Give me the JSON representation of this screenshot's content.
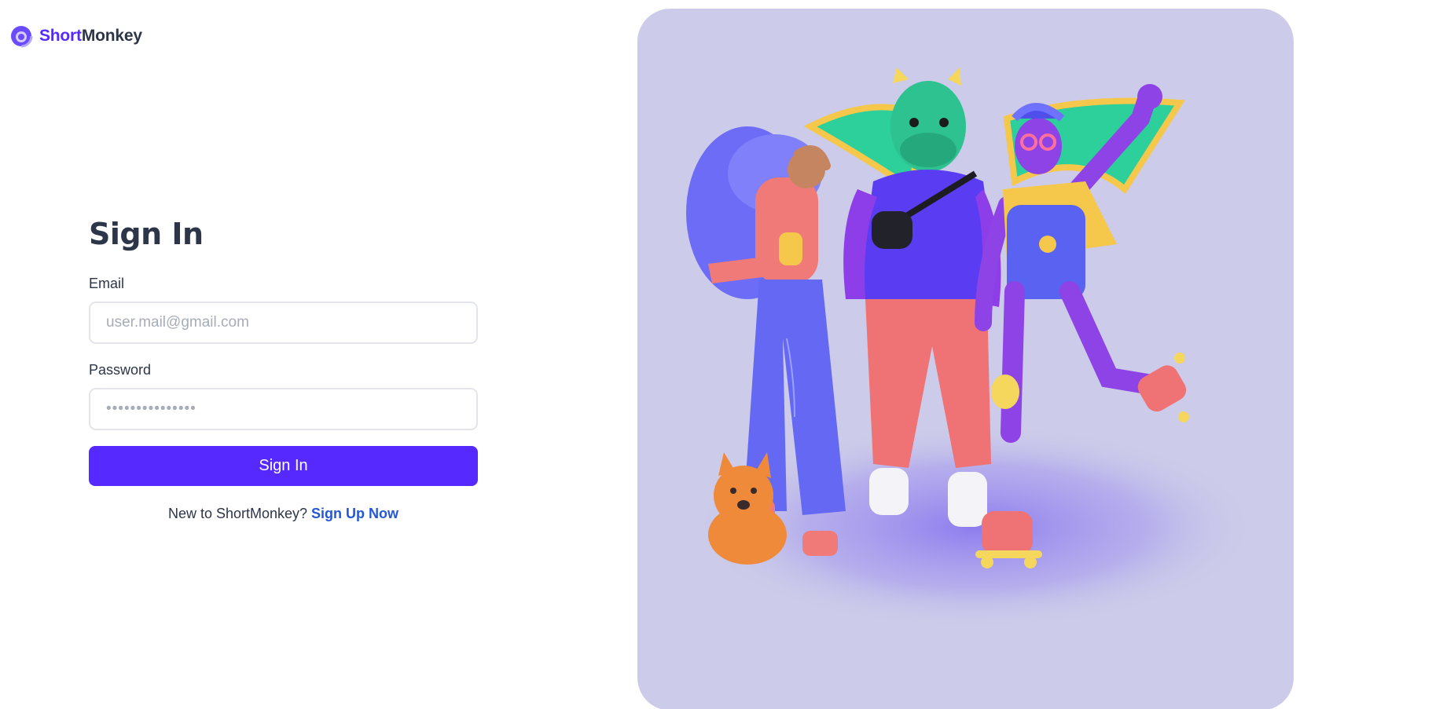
{
  "brand": {
    "name_part1": "Short",
    "name_part2": "Monkey",
    "logo_icon": "swirl-logo-icon",
    "accent_color": "#5529ff"
  },
  "form": {
    "title": "Sign In",
    "email_label": "Email",
    "email_placeholder": "user.mail@gmail.com",
    "password_label": "Password",
    "password_placeholder": "•••••••••••••••",
    "submit_label": "Sign In",
    "signup_prompt": "New to ShortMonkey?",
    "signup_link": "Sign Up Now"
  },
  "hero": {
    "background_color": "#cccbe9",
    "image": "group-of-3d-characters-illustration"
  }
}
